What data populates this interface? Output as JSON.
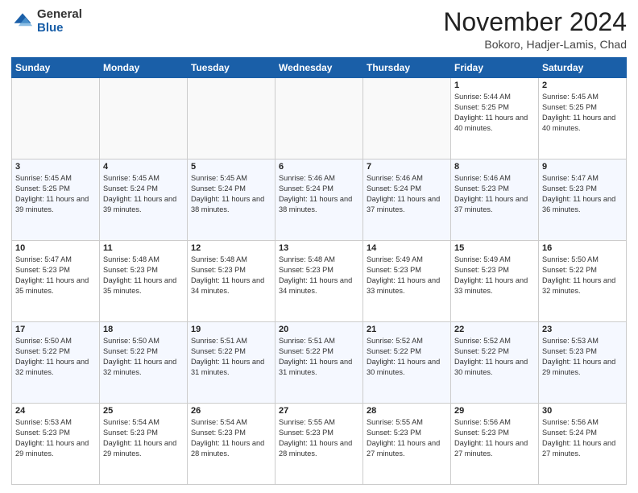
{
  "header": {
    "logo": {
      "general": "General",
      "blue": "Blue"
    },
    "title": "November 2024",
    "location": "Bokoro, Hadjer-Lamis, Chad"
  },
  "weekdays": [
    "Sunday",
    "Monday",
    "Tuesday",
    "Wednesday",
    "Thursday",
    "Friday",
    "Saturday"
  ],
  "weeks": [
    [
      {
        "day": "",
        "info": ""
      },
      {
        "day": "",
        "info": ""
      },
      {
        "day": "",
        "info": ""
      },
      {
        "day": "",
        "info": ""
      },
      {
        "day": "",
        "info": ""
      },
      {
        "day": "1",
        "info": "Sunrise: 5:44 AM\nSunset: 5:25 PM\nDaylight: 11 hours and 40 minutes."
      },
      {
        "day": "2",
        "info": "Sunrise: 5:45 AM\nSunset: 5:25 PM\nDaylight: 11 hours and 40 minutes."
      }
    ],
    [
      {
        "day": "3",
        "info": "Sunrise: 5:45 AM\nSunset: 5:25 PM\nDaylight: 11 hours and 39 minutes."
      },
      {
        "day": "4",
        "info": "Sunrise: 5:45 AM\nSunset: 5:24 PM\nDaylight: 11 hours and 39 minutes."
      },
      {
        "day": "5",
        "info": "Sunrise: 5:45 AM\nSunset: 5:24 PM\nDaylight: 11 hours and 38 minutes."
      },
      {
        "day": "6",
        "info": "Sunrise: 5:46 AM\nSunset: 5:24 PM\nDaylight: 11 hours and 38 minutes."
      },
      {
        "day": "7",
        "info": "Sunrise: 5:46 AM\nSunset: 5:24 PM\nDaylight: 11 hours and 37 minutes."
      },
      {
        "day": "8",
        "info": "Sunrise: 5:46 AM\nSunset: 5:23 PM\nDaylight: 11 hours and 37 minutes."
      },
      {
        "day": "9",
        "info": "Sunrise: 5:47 AM\nSunset: 5:23 PM\nDaylight: 11 hours and 36 minutes."
      }
    ],
    [
      {
        "day": "10",
        "info": "Sunrise: 5:47 AM\nSunset: 5:23 PM\nDaylight: 11 hours and 35 minutes."
      },
      {
        "day": "11",
        "info": "Sunrise: 5:48 AM\nSunset: 5:23 PM\nDaylight: 11 hours and 35 minutes."
      },
      {
        "day": "12",
        "info": "Sunrise: 5:48 AM\nSunset: 5:23 PM\nDaylight: 11 hours and 34 minutes."
      },
      {
        "day": "13",
        "info": "Sunrise: 5:48 AM\nSunset: 5:23 PM\nDaylight: 11 hours and 34 minutes."
      },
      {
        "day": "14",
        "info": "Sunrise: 5:49 AM\nSunset: 5:23 PM\nDaylight: 11 hours and 33 minutes."
      },
      {
        "day": "15",
        "info": "Sunrise: 5:49 AM\nSunset: 5:23 PM\nDaylight: 11 hours and 33 minutes."
      },
      {
        "day": "16",
        "info": "Sunrise: 5:50 AM\nSunset: 5:22 PM\nDaylight: 11 hours and 32 minutes."
      }
    ],
    [
      {
        "day": "17",
        "info": "Sunrise: 5:50 AM\nSunset: 5:22 PM\nDaylight: 11 hours and 32 minutes."
      },
      {
        "day": "18",
        "info": "Sunrise: 5:50 AM\nSunset: 5:22 PM\nDaylight: 11 hours and 32 minutes."
      },
      {
        "day": "19",
        "info": "Sunrise: 5:51 AM\nSunset: 5:22 PM\nDaylight: 11 hours and 31 minutes."
      },
      {
        "day": "20",
        "info": "Sunrise: 5:51 AM\nSunset: 5:22 PM\nDaylight: 11 hours and 31 minutes."
      },
      {
        "day": "21",
        "info": "Sunrise: 5:52 AM\nSunset: 5:22 PM\nDaylight: 11 hours and 30 minutes."
      },
      {
        "day": "22",
        "info": "Sunrise: 5:52 AM\nSunset: 5:22 PM\nDaylight: 11 hours and 30 minutes."
      },
      {
        "day": "23",
        "info": "Sunrise: 5:53 AM\nSunset: 5:23 PM\nDaylight: 11 hours and 29 minutes."
      }
    ],
    [
      {
        "day": "24",
        "info": "Sunrise: 5:53 AM\nSunset: 5:23 PM\nDaylight: 11 hours and 29 minutes."
      },
      {
        "day": "25",
        "info": "Sunrise: 5:54 AM\nSunset: 5:23 PM\nDaylight: 11 hours and 29 minutes."
      },
      {
        "day": "26",
        "info": "Sunrise: 5:54 AM\nSunset: 5:23 PM\nDaylight: 11 hours and 28 minutes."
      },
      {
        "day": "27",
        "info": "Sunrise: 5:55 AM\nSunset: 5:23 PM\nDaylight: 11 hours and 28 minutes."
      },
      {
        "day": "28",
        "info": "Sunrise: 5:55 AM\nSunset: 5:23 PM\nDaylight: 11 hours and 27 minutes."
      },
      {
        "day": "29",
        "info": "Sunrise: 5:56 AM\nSunset: 5:23 PM\nDaylight: 11 hours and 27 minutes."
      },
      {
        "day": "30",
        "info": "Sunrise: 5:56 AM\nSunset: 5:24 PM\nDaylight: 11 hours and 27 minutes."
      }
    ]
  ]
}
